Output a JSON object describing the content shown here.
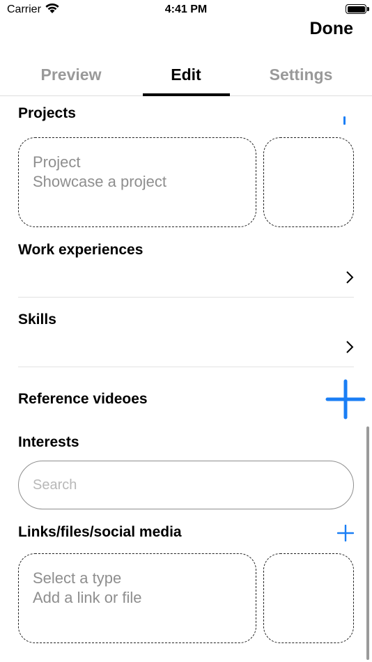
{
  "status_bar": {
    "carrier": "Carrier",
    "time": "4:41 PM"
  },
  "header": {
    "done_label": "Done"
  },
  "tabs": [
    {
      "label": "Preview",
      "active": false
    },
    {
      "label": "Edit",
      "active": true
    },
    {
      "label": "Settings",
      "active": false
    }
  ],
  "sections": {
    "projects": {
      "title": "Projects",
      "card_line1": "Project",
      "card_line2": "Showcase a project"
    },
    "work": {
      "title": "Work experiences"
    },
    "skills": {
      "title": "Skills"
    },
    "videos": {
      "title": "Reference videoes"
    },
    "interests": {
      "title": "Interests",
      "search_placeholder": "Search"
    },
    "links": {
      "title": "Links/files/social media",
      "card_line1": "Select a type",
      "card_line2": "Add a link or file"
    }
  },
  "colors": {
    "accent": "#1a7ef5",
    "inactive_tab": "#999999",
    "placeholder": "#8e8e8e"
  },
  "icons": [
    "wifi-icon",
    "battery-icon",
    "chevron-right-icon",
    "plus-icon"
  ]
}
